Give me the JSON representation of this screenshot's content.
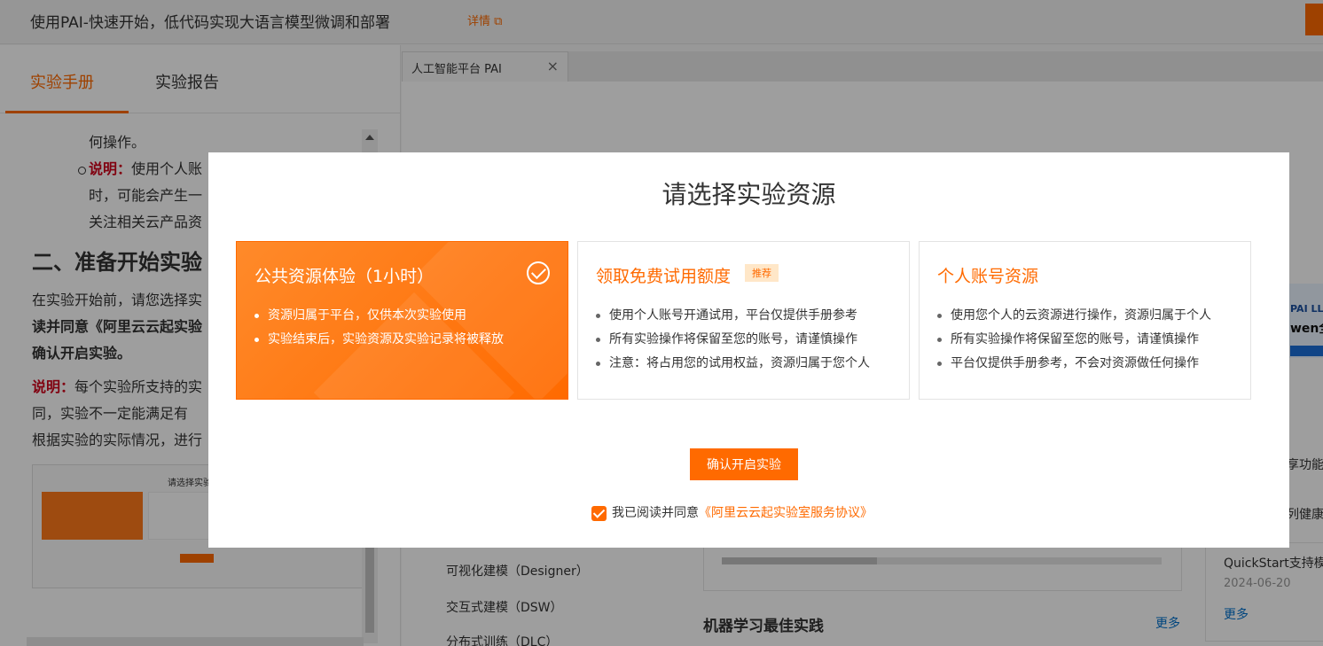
{
  "header": {
    "title": "使用PAI-快速开始，低代码实现大语言模型微调和部署",
    "detail_link": "详情"
  },
  "left_panel": {
    "tabs": [
      {
        "label": "实验手册",
        "active": true
      },
      {
        "label": "实验报告",
        "active": false
      }
    ],
    "doc": {
      "line1": "何操作。",
      "note_label": "说明：",
      "note_line1": "使用个人账",
      "note_line2": "时，可能会产生一",
      "note_line3": "关注相关云产品资",
      "section_heading": "二、准备开始实验",
      "para1_line1": "在实验开始前，请您选择实",
      "para1_line2": "读并同意《阿里云云起实验",
      "para1_line3": "确认开启实验。",
      "note2_label": "说明：",
      "note2_line1": "每个实验所支持的实",
      "note2_line2": "同，实验不一定能满足有",
      "note2_line3": "根据实验的实际情况，进行",
      "mini_title": "请选择实验"
    }
  },
  "browser_tab": {
    "label": "人工智能平台 PAI",
    "close": "×"
  },
  "right_content": {
    "nav_items": [
      "可视化建模（Designer）",
      "交互式建模（DSW）",
      "分布式训练（DLC）"
    ],
    "best_practice_title": "机器学习最佳实践",
    "more_label": "更多",
    "news": {
      "title": "QuickStart支持模",
      "date": "2024-06-20",
      "more": "更多"
    },
    "edge_text_1": "享功能",
    "edge_text_2": "列健康",
    "banner_line1": "PAI LLM",
    "banner_line2": "wen全"
  },
  "modal": {
    "title": "请选择实验资源",
    "options": [
      {
        "title": "公共资源体验（1小时）",
        "selected": true,
        "bullets": [
          "资源归属于平台，仅供本次实验使用",
          "实验结束后，实验资源及实验记录将被释放"
        ]
      },
      {
        "title": "领取免费试用额度",
        "tag": "推荐",
        "selected": false,
        "bullets": [
          "使用个人账号开通试用，平台仅提供手册参考",
          "所有实验操作将保留至您的账号，请谨慎操作",
          "注意：将占用您的试用权益，资源归属于您个人"
        ]
      },
      {
        "title": "个人账号资源",
        "selected": false,
        "bullets": [
          "使用您个人的云资源进行操作，资源归属于个人",
          "所有实验操作将保留至您的账号，请谨慎操作",
          "平台仅提供手册参考，不会对资源做任何操作"
        ]
      }
    ],
    "confirm_button": "确认开启实验",
    "agree_text": "我已阅读并同意",
    "agree_link": "《阿里云云起实验室服务协议》",
    "agree_checked": true
  },
  "colors": {
    "accent": "#ff6a00",
    "link": "#0070cc",
    "danger": "#d0021b"
  }
}
